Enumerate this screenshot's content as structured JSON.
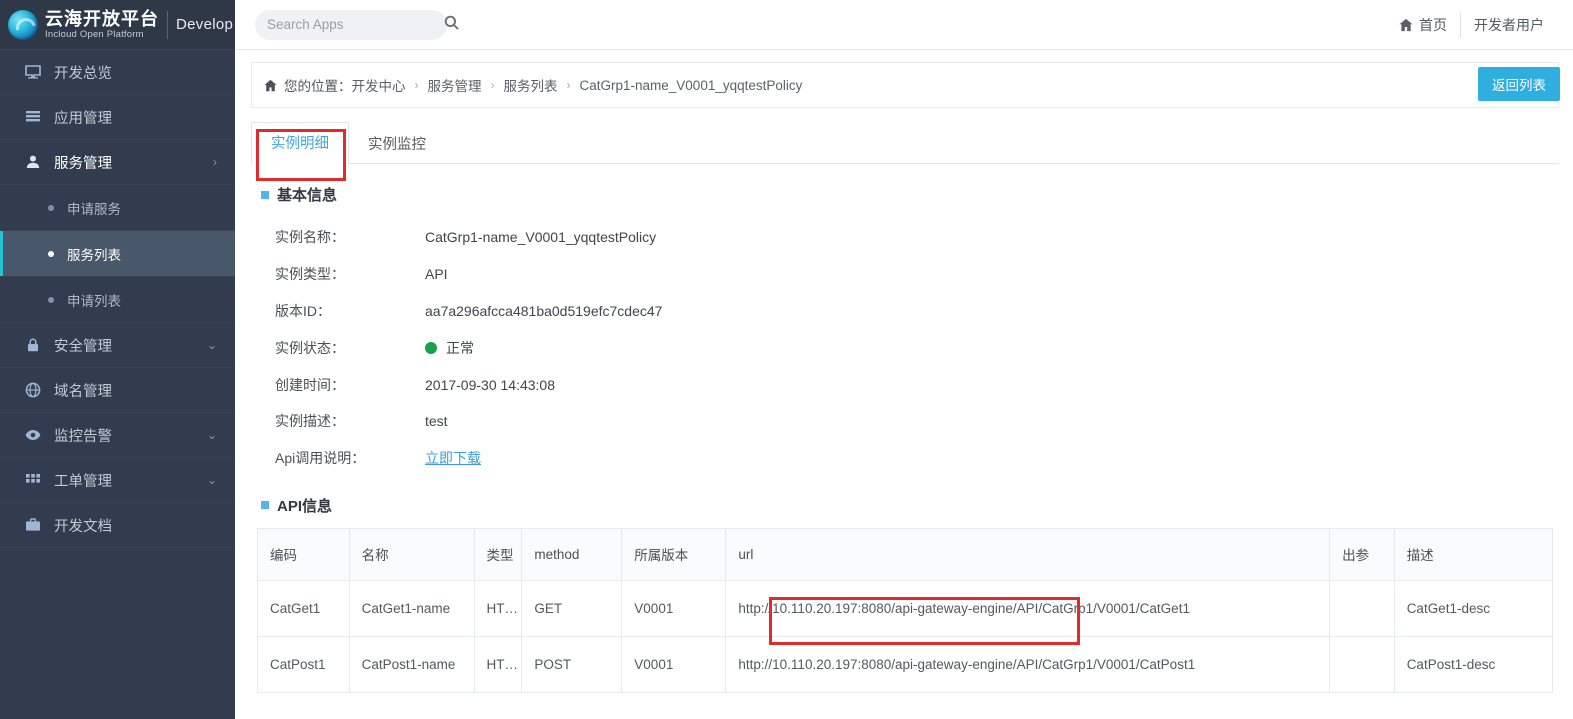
{
  "brand": {
    "name_cn": "云海开放平台",
    "name_en": "Incloud Open Platform",
    "suffix": "Develop",
    "logo_icon": "cloud-swirl-logo-icon"
  },
  "sidebar": {
    "items": [
      {
        "label": "开发总览",
        "icon": "monitor-icon",
        "caret": ""
      },
      {
        "label": "应用管理",
        "icon": "list-icon",
        "caret": ""
      },
      {
        "label": "服务管理",
        "icon": "user-icon",
        "caret": "›",
        "expanded": true
      },
      {
        "label": "安全管理",
        "icon": "lock-icon",
        "caret": "⌄"
      },
      {
        "label": "域名管理",
        "icon": "globe-icon",
        "caret": ""
      },
      {
        "label": "监控告警",
        "icon": "eye-icon",
        "caret": "⌄"
      },
      {
        "label": "工单管理",
        "icon": "grid-icon",
        "caret": "⌄"
      },
      {
        "label": "开发文档",
        "icon": "briefcase-icon",
        "caret": ""
      }
    ],
    "subitems": [
      {
        "label": "申请服务",
        "active": false
      },
      {
        "label": "服务列表",
        "active": true
      },
      {
        "label": "申请列表",
        "active": false
      }
    ]
  },
  "topbar": {
    "search_placeholder": "Search Apps",
    "search_value": "",
    "search_icon": "search-icon",
    "home_label": "首页",
    "home_icon": "home-icon",
    "user_label": "开发者用户"
  },
  "breadcrumb": {
    "icon": "home-icon",
    "prefix": "您的位置：",
    "items": [
      "开发中心",
      "服务管理",
      "服务列表",
      "CatGrp1-name_V0001_yqqtestPolicy"
    ],
    "separator": "›",
    "back_button": "返回列表"
  },
  "tabs": [
    {
      "label": "实例明细",
      "active": true
    },
    {
      "label": "实例监控",
      "active": false
    }
  ],
  "basic_info": {
    "section_title": "基本信息",
    "rows": [
      {
        "label": "实例名称：",
        "value": "CatGrp1-name_V0001_yqqtestPolicy",
        "type": "text"
      },
      {
        "label": "实例类型：",
        "value": "API",
        "type": "text"
      },
      {
        "label": "版本ID：",
        "value": "aa7a296afcca481ba0d519efc7cdec47",
        "type": "text"
      },
      {
        "label": "实例状态：",
        "value": "正常",
        "type": "status",
        "status_color": "#17a34a"
      },
      {
        "label": "创建时间：",
        "value": "2017-09-30 14:43:08",
        "type": "text"
      },
      {
        "label": "实例描述：",
        "value": "test",
        "type": "text"
      },
      {
        "label": "Api调用说明：",
        "value": "立即下载",
        "type": "link"
      }
    ]
  },
  "api_info": {
    "section_title": "API信息",
    "columns": [
      "编码",
      "名称",
      "类型",
      "method",
      "所属版本",
      "url",
      "出参",
      "描述"
    ],
    "rows": [
      {
        "code": "CatGet1",
        "name": "CatGet1-name",
        "type": "HTTP",
        "method": "GET",
        "version": "V0001",
        "url": "http://10.110.20.197:8080/api-gateway-engine/API/CatGrp1/V0001/CatGet1",
        "out": "",
        "desc": "CatGet1-desc"
      },
      {
        "code": "CatPost1",
        "name": "CatPost1-name",
        "type": "HTTP",
        "method": "POST",
        "version": "V0001",
        "url": "http://10.110.20.197:8080/api-gateway-engine/API/CatGrp1/V0001/CatPost1",
        "out": "",
        "desc": "CatPost1-desc"
      }
    ]
  },
  "annotations": {
    "accent_red": "#e02b2b",
    "accent_blue": "#2eafe0",
    "sidebar_bg": "#323c4e",
    "active_sub_bg": "#49576b",
    "active_sub_bar": "#29c0d4"
  }
}
